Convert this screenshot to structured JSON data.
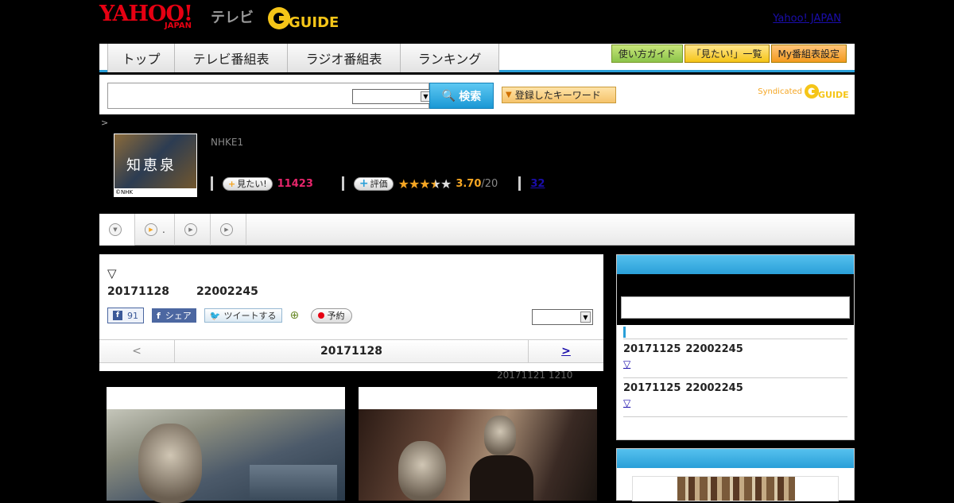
{
  "header": {
    "logo_yahoo": "YAHOO!",
    "logo_japan": "JAPAN",
    "logo_tv": "テレビ",
    "logo_gguide": "GUIDE",
    "top_link": "Yahoo! JAPAN"
  },
  "nav": {
    "tabs": [
      "トップ",
      "テレビ番組表",
      "ラジオ番組表",
      "ランキング"
    ],
    "buttons": [
      "使い方ガイド",
      "「見たい!」一覧",
      "My番組表設定"
    ]
  },
  "search": {
    "button_label": "検索",
    "keyword_button": "登録したキーワード",
    "syndicated": "Syndicated",
    "syndicated_logo": "GUIDE"
  },
  "breadcrumb": ">",
  "program": {
    "thumb_title": "知恵泉",
    "thumb_copyright": "©NHK",
    "channel": "NHKE1",
    "want_label": "見たい!",
    "want_count": "11423",
    "rate_label": "評価",
    "score": "3.70",
    "score_total": "/20",
    "review_count": "32"
  },
  "tabs": {
    "tab2_text": "."
  },
  "main": {
    "marker": "▽",
    "date": "20171128",
    "time": "22002245",
    "fb_like_count": "91",
    "fb_share": "シェア",
    "tweet": "ツイートする",
    "reserve": "予約",
    "pager_prev": "<",
    "pager_date": "20171128",
    "pager_next": ">",
    "updated": "20171121  1210"
  },
  "sidebar": {
    "items": [
      {
        "date": "20171125",
        "time": "22002245",
        "link": "▽"
      },
      {
        "date": "20171125",
        "time": "22002245",
        "link": "▽"
      }
    ]
  },
  "colors": {
    "accent": "#2a9fd8",
    "yahoo_red": "#e60012",
    "want_pink": "#e6256b",
    "star": "#f5a623"
  }
}
